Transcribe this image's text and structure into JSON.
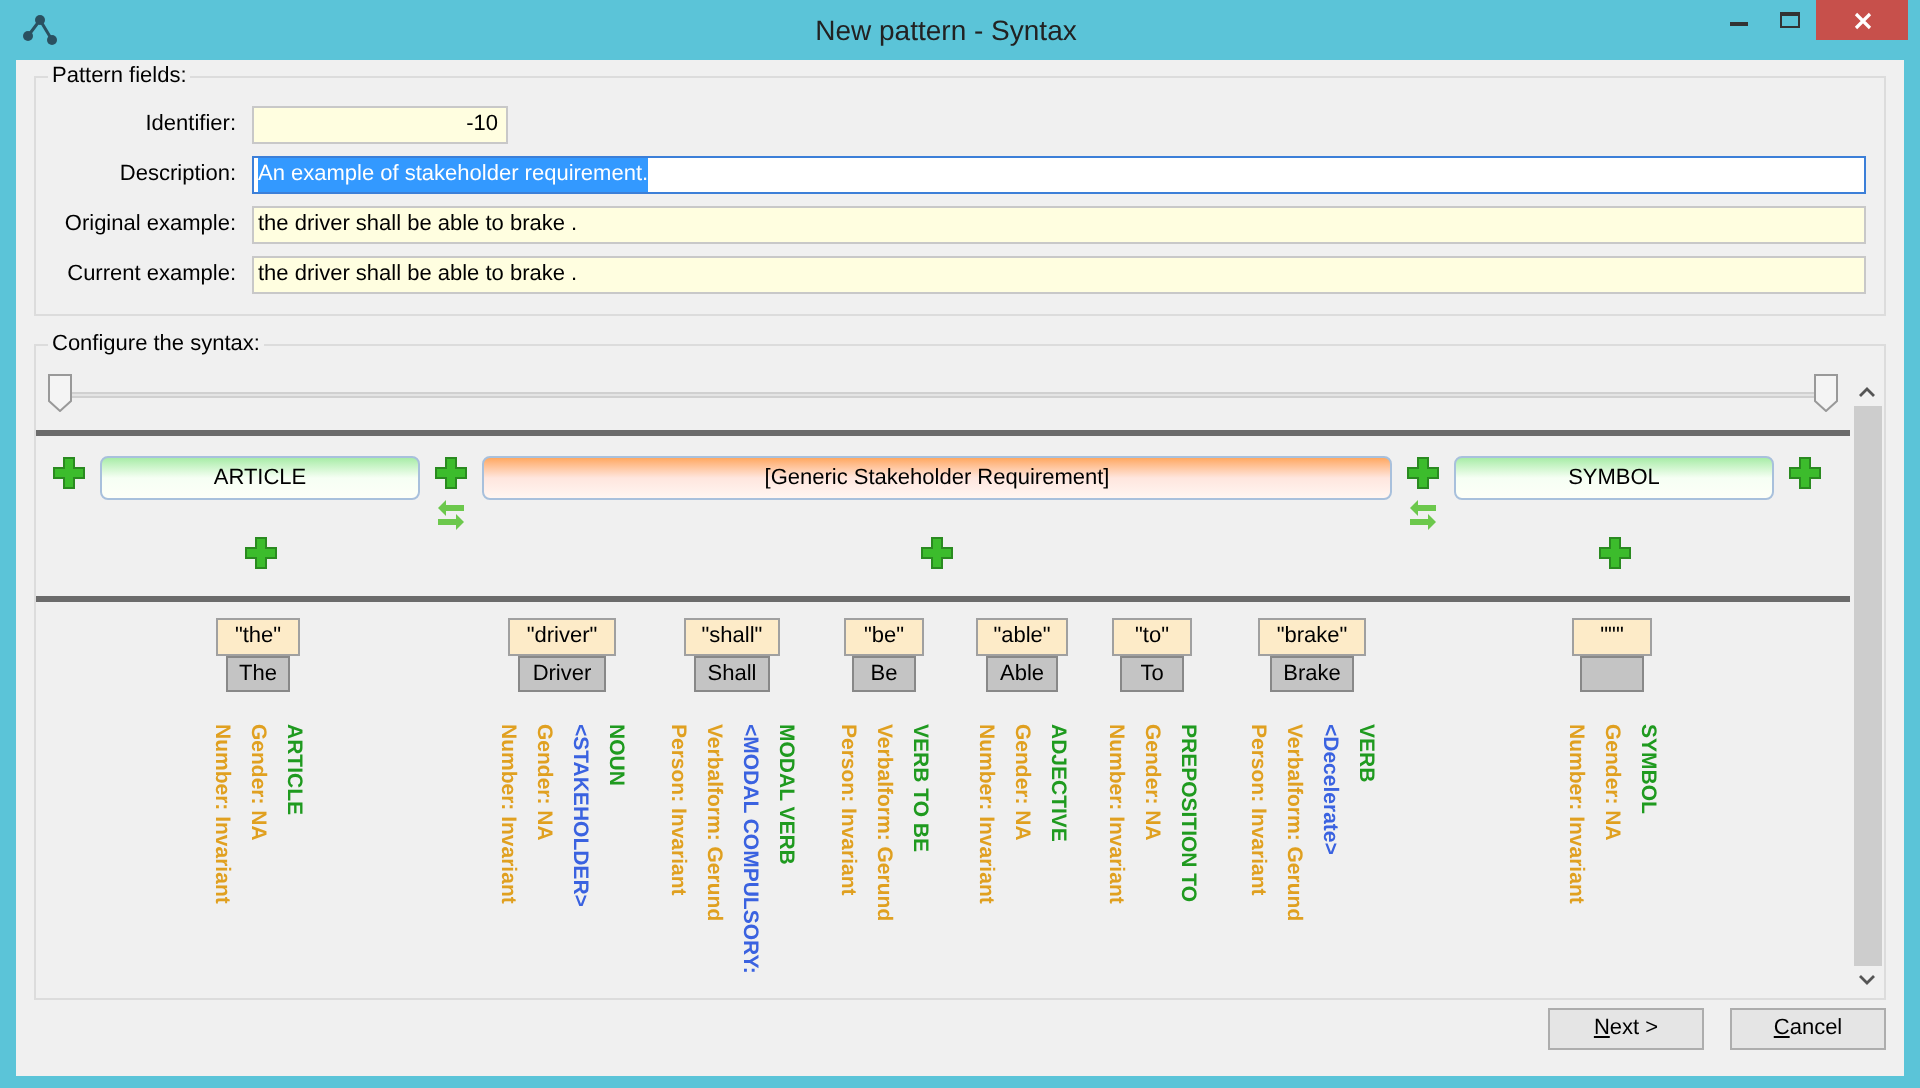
{
  "window": {
    "title": "New pattern - Syntax"
  },
  "pattern_fields": {
    "title": "Pattern fields:",
    "fields": [
      {
        "label": "Identifier:",
        "value": "-10",
        "kind": "number",
        "text_selected": false
      },
      {
        "label": "Description:",
        "value": "An example of stakeholder requirement.",
        "kind": "text",
        "text_selected": true
      },
      {
        "label": "Original example:",
        "value": "the driver shall be able to brake .",
        "kind": "text",
        "text_selected": false
      },
      {
        "label": "Current example:",
        "value": "the driver shall be able to brake .",
        "kind": "text",
        "text_selected": false
      }
    ]
  },
  "syntax": {
    "title": "Configure the syntax:",
    "slider_thumbs": [
      {
        "level": 0
      },
      {
        "level": 1
      }
    ],
    "elements": [
      {
        "label": "ARTICLE",
        "kind": "grammar"
      },
      {
        "label": "[Generic Stakeholder Requirement]",
        "kind": "requirement"
      },
      {
        "label": "SYMBOL",
        "kind": "grammar"
      }
    ],
    "tokens": [
      {
        "word": "\"the\"",
        "lemma": "The",
        "lines": [
          {
            "text": "ARTICLE",
            "kind": "category"
          },
          {
            "text": "Gender: NA",
            "kind": "feature"
          },
          {
            "text": "Number: Invariant",
            "kind": "feature"
          }
        ]
      },
      {
        "word": "\"driver\"",
        "lemma": "Driver",
        "lines": [
          {
            "text": "NOUN",
            "kind": "category"
          },
          {
            "text": "<STAKEHOLDER>",
            "kind": "semantic"
          },
          {
            "text": "Gender: NA",
            "kind": "feature"
          },
          {
            "text": "Number: Invariant",
            "kind": "feature"
          }
        ]
      },
      {
        "word": "\"shall\"",
        "lemma": "Shall",
        "lines": [
          {
            "text": "MODAL VERB",
            "kind": "category"
          },
          {
            "text": "<MODAL COMPULSORY:",
            "kind": "semantic"
          },
          {
            "text": "Verbalform: Gerund",
            "kind": "feature"
          },
          {
            "text": "Person: Invariant",
            "kind": "feature"
          }
        ]
      },
      {
        "word": "\"be\"",
        "lemma": "Be",
        "lines": [
          {
            "text": "VERB TO BE",
            "kind": "category"
          },
          {
            "text": "Verbalform: Gerund",
            "kind": "feature"
          },
          {
            "text": "Person: Invariant",
            "kind": "feature"
          }
        ]
      },
      {
        "word": "\"able\"",
        "lemma": "Able",
        "lines": [
          {
            "text": "ADJECTIVE",
            "kind": "category"
          },
          {
            "text": "Gender: NA",
            "kind": "feature"
          },
          {
            "text": "Number: Invariant",
            "kind": "feature"
          }
        ]
      },
      {
        "word": "\"to\"",
        "lemma": "To",
        "lines": [
          {
            "text": "PREPOSITION TO",
            "kind": "category"
          },
          {
            "text": "Gender: NA",
            "kind": "feature"
          },
          {
            "text": "Number: Invariant",
            "kind": "feature"
          }
        ]
      },
      {
        "word": "\"brake\"",
        "lemma": "Brake",
        "lines": [
          {
            "text": "VERB",
            "kind": "category"
          },
          {
            "text": "<Decelerate>",
            "kind": "semantic"
          },
          {
            "text": "Verbalform: Gerund",
            "kind": "feature"
          },
          {
            "text": "Person: Invariant",
            "kind": "feature"
          }
        ]
      },
      {
        "word": "\"\"\"",
        "lines": [
          {
            "text": "SYMBOL",
            "kind": "category"
          },
          {
            "text": "Gender: NA",
            "kind": "feature"
          },
          {
            "text": "Number: Invariant",
            "kind": "feature"
          }
        ]
      }
    ]
  },
  "buttons": [
    {
      "mnemonic": "N",
      "rest": "ext >"
    },
    {
      "mnemonic": "C",
      "rest": "ancel"
    }
  ]
}
